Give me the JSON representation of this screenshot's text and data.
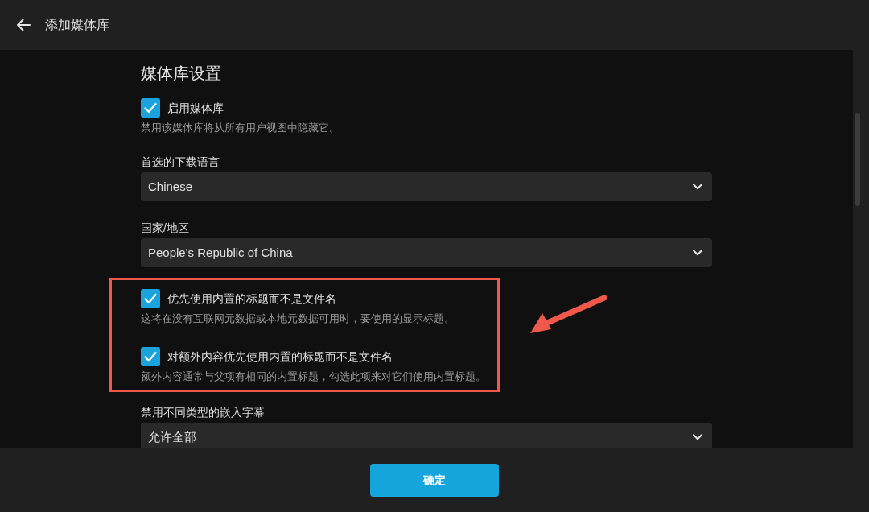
{
  "header": {
    "title": "添加媒体库"
  },
  "section": {
    "title": "媒体库设置"
  },
  "settings": [
    {
      "kind": "checkbox",
      "label": "启用媒体库",
      "checked": true,
      "description": "禁用该媒体库将从所有用户视图中隐藏它。",
      "highlighted": false
    },
    {
      "kind": "select",
      "label": "首选的下载语言",
      "value": "Chinese",
      "highlighted": false
    },
    {
      "kind": "select",
      "label": "国家/地区",
      "value": "People's Republic of China",
      "highlighted": false
    },
    {
      "kind": "checkbox",
      "label": "优先使用内置的标题而不是文件名",
      "checked": true,
      "description": "这将在没有互联网元数据或本地元数据可用时，要使用的显示标题。",
      "highlighted": true
    },
    {
      "kind": "checkbox",
      "label": "对额外内容优先使用内置的标题而不是文件名",
      "checked": true,
      "description": "额外内容通常与父项有相同的内置标题，勾选此项来对它们使用内置标题。",
      "highlighted": true
    },
    {
      "kind": "select",
      "label": "禁用不同类型的嵌入字幕",
      "value": "允许全部",
      "highlighted": false
    }
  ],
  "footer": {
    "button": "确定"
  }
}
